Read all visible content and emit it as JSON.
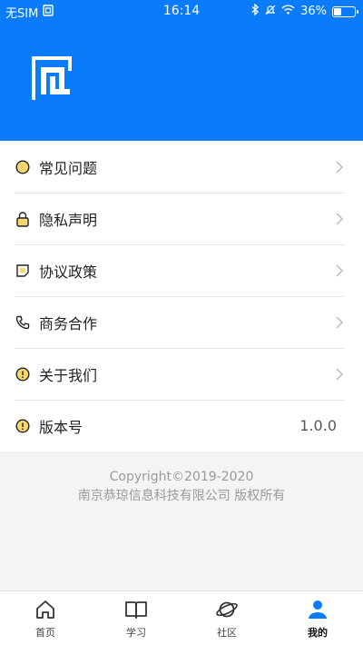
{
  "status_bar": {
    "carrier": "无SIM",
    "time": "16:14",
    "battery_text": "36%",
    "battery_level": 0.36,
    "icons": [
      "sim-icon",
      "bluetooth-icon",
      "do-not-disturb-icon",
      "wifi-icon",
      "battery-icon"
    ]
  },
  "colors": {
    "header_blue": "#0a7cf9",
    "active_tab_blue": "#0a7cf9",
    "icon_yellow": "#f5d76e"
  },
  "menu": {
    "items": [
      {
        "label": "常见问题",
        "icon": "help-circle-icon"
      },
      {
        "label": "隐私声明",
        "icon": "lock-icon"
      },
      {
        "label": "协议政策",
        "icon": "document-icon"
      },
      {
        "label": "商务合作",
        "icon": "phone-icon"
      },
      {
        "label": "关于我们",
        "icon": "info-circle-icon"
      },
      {
        "label": "版本号",
        "icon": "info-circle-icon",
        "value": "1.0.0"
      }
    ]
  },
  "footer": {
    "copyright": "Copyright©2019-2020",
    "company": "南京恭琼信息科技有限公司 版权所有"
  },
  "tabbar": {
    "tabs": [
      {
        "label": "首页",
        "icon": "home-icon"
      },
      {
        "label": "学习",
        "icon": "book-icon"
      },
      {
        "label": "社区",
        "icon": "planet-icon"
      },
      {
        "label": "我的",
        "icon": "user-icon",
        "active": true
      }
    ]
  }
}
